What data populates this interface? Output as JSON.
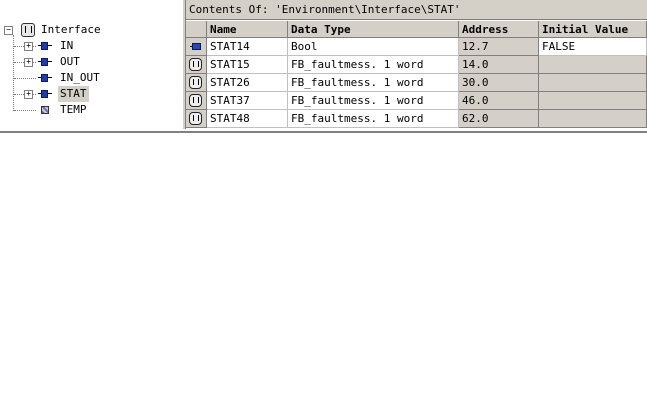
{
  "tree": {
    "root": {
      "label": "Interface",
      "icon": "interface-icon"
    },
    "items": [
      {
        "label": "IN",
        "expandable": true,
        "icon": "in-port-icon"
      },
      {
        "label": "OUT",
        "expandable": true,
        "icon": "out-port-icon"
      },
      {
        "label": "IN_OUT",
        "expandable": false,
        "icon": "inout-port-icon"
      },
      {
        "label": "STAT",
        "expandable": true,
        "icon": "stat-port-icon",
        "selected": true
      },
      {
        "label": "TEMP",
        "expandable": false,
        "icon": "temp-icon"
      }
    ],
    "expand_glyph": "+",
    "collapse_glyph": "−"
  },
  "contents": {
    "caption": "Contents Of: 'Environment\\Interface\\STAT'",
    "columns": {
      "name": "Name",
      "data_type": "Data Type",
      "address": "Address",
      "initial_value": "Initial Value"
    },
    "rows": [
      {
        "icon": "variable-icon",
        "name": "STAT14",
        "data_type": "Bool",
        "address": "12.7",
        "initial_value": "FALSE"
      },
      {
        "icon": "fb-instance-icon",
        "name": "STAT15",
        "data_type": "FB_faultmess. 1 word",
        "address": "14.0",
        "initial_value": ""
      },
      {
        "icon": "fb-instance-icon",
        "name": "STAT26",
        "data_type": "FB_faultmess. 1 word",
        "address": "30.0",
        "initial_value": ""
      },
      {
        "icon": "fb-instance-icon",
        "name": "STAT37",
        "data_type": "FB_faultmess. 1 word",
        "address": "46.0",
        "initial_value": ""
      },
      {
        "icon": "fb-instance-icon",
        "name": "STAT48",
        "data_type": "FB_faultmess. 1 word",
        "address": "62.0",
        "initial_value": ""
      }
    ]
  },
  "colors": {
    "panel": "#d4d0c8",
    "port_blue": "#1c3ea8",
    "grid": "#c0c0c0"
  }
}
